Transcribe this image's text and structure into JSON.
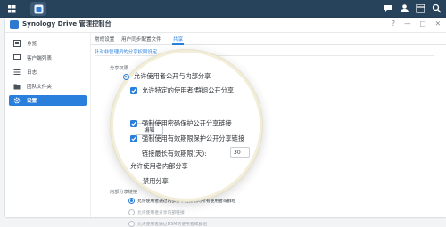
{
  "taskbar": {
    "left_icons": [
      "grid-icon",
      "synology-drive-app-icon"
    ],
    "right_icons": [
      "chat-icon",
      "user-icon",
      "widgets-icon",
      "search-icon"
    ]
  },
  "window": {
    "title": "Synology Drive 管理控制台",
    "controls": [
      "?",
      "—",
      "□",
      "✕"
    ]
  },
  "sidebar": {
    "items": [
      {
        "label": "总览",
        "icon": "overview-icon",
        "active": false
      },
      {
        "label": "客户端列表",
        "icon": "client-list-icon",
        "active": false
      },
      {
        "label": "日志",
        "icon": "log-icon",
        "active": false
      },
      {
        "label": "团队文件夹",
        "icon": "team-folder-icon",
        "active": false
      },
      {
        "label": "设置",
        "icon": "gear-icon",
        "active": true
      }
    ]
  },
  "tabs": [
    {
      "label": "常规设置",
      "active": false
    },
    {
      "label": "用户同步配置文件",
      "active": false
    },
    {
      "label": "共享",
      "active": true
    }
  ],
  "subhead": "针对非管理员的分享权限设定",
  "sharing": {
    "section_label": "分享权限",
    "option_public_internal": "允许使用者公开与内部分享",
    "option_specific_groups": "允许特定的使用者/群组公开分享",
    "edit_button": "编辑",
    "option_enforce_password": "强制使用密码保护公开分享链接",
    "option_enforce_expiry": "强制使用有效期限保护公开分享链接",
    "max_days_label": "链接最长有效期限(天):",
    "max_days_value": "30",
    "option_internal_only": "允许使用者内部分享",
    "option_disable": "禁用分享"
  },
  "internal": {
    "section_label": "内部分享链接",
    "options": [
      {
        "label": "允许使用者通过内部分享链接访问所有使用者或群组",
        "selected": true
      },
      {
        "label": "允许使用者分享内部链接",
        "selected": false
      },
      {
        "label": "允许使用者通过DSM的使用者或群组",
        "selected": false
      }
    ]
  }
}
